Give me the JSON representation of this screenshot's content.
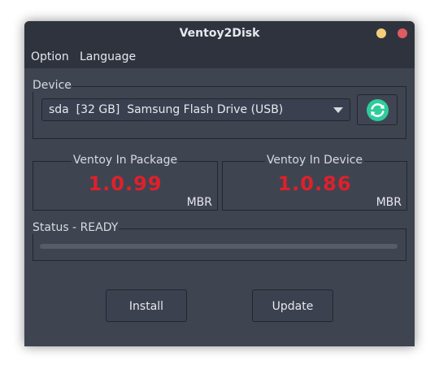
{
  "window": {
    "title": "Ventoy2Disk"
  },
  "menu": {
    "option": "Option",
    "language": "Language"
  },
  "device": {
    "label": "Device",
    "selected": "sda  [32 GB]  Samsung Flash Drive (USB)"
  },
  "package": {
    "label": "Ventoy In Package",
    "version": "1.0.99",
    "partition_style": "MBR"
  },
  "installed": {
    "label": "Ventoy In Device",
    "version": "1.0.86",
    "partition_style": "MBR"
  },
  "status": {
    "label": "Status - READY",
    "progress": 0
  },
  "buttons": {
    "install": "Install",
    "update": "Update"
  },
  "colors": {
    "version_text": "#e0202a",
    "refresh_icon": "#2ecc9a"
  },
  "icons": {
    "refresh": "refresh-icon",
    "dropdown": "chevron-down-icon"
  }
}
